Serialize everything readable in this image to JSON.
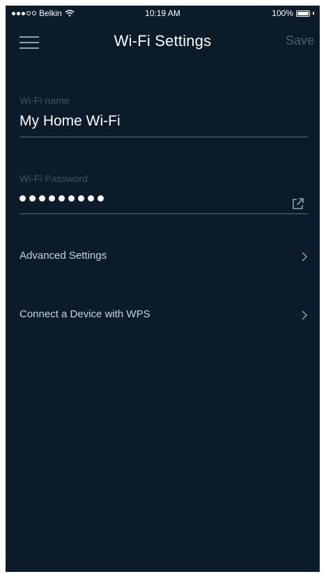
{
  "status_bar": {
    "carrier": "Belkin",
    "time": "10:19 AM",
    "battery": "100%"
  },
  "header": {
    "title": "Wi-Fi Settings",
    "save_label": "Save",
    "menu_icon": "hamburger-menu-icon"
  },
  "wifi_name": {
    "label": "Wi-Fi name",
    "value": "My Home Wi-Fi"
  },
  "wifi_password": {
    "label": "Wi-Fi Password",
    "masked_length": 9,
    "share_icon": "share-external-icon"
  },
  "menu": {
    "items": [
      {
        "label": "Advanced Settings",
        "icon": "chevron-right-icon"
      },
      {
        "label": "Connect a Device with WPS",
        "icon": "chevron-right-icon"
      }
    ]
  },
  "colors": {
    "background": "#0c1b29",
    "text_primary": "#ffffff",
    "text_muted": "#3e5063",
    "save_disabled": "#4e5e6e"
  }
}
